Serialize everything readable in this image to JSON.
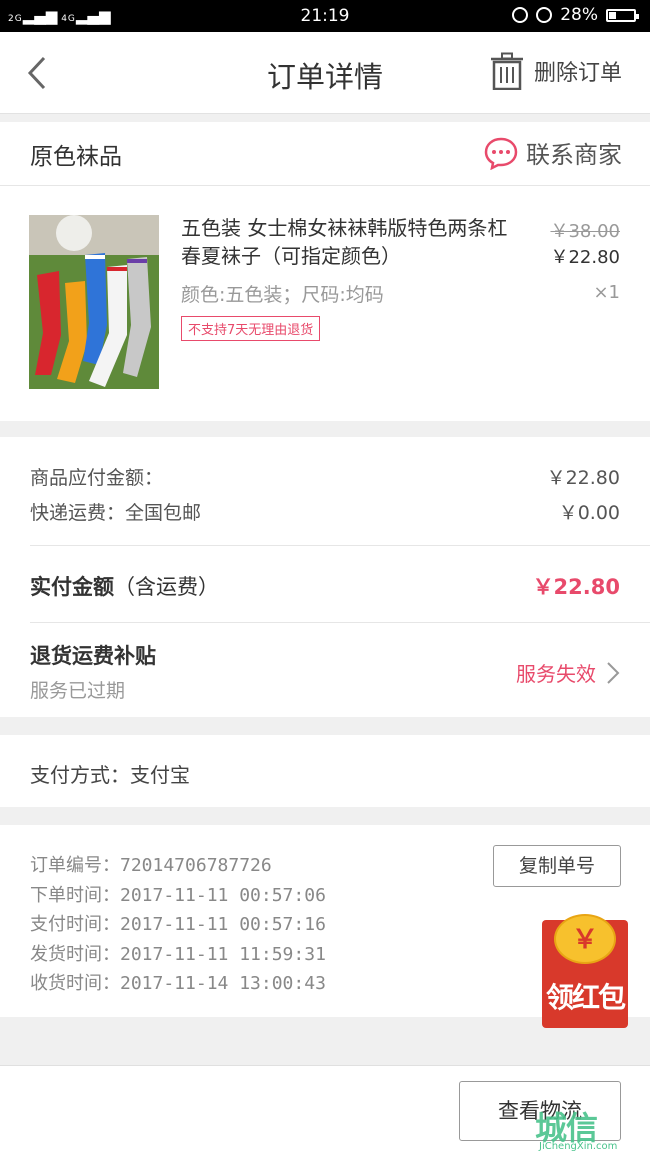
{
  "status_bar": {
    "network_left": "2G",
    "network_right": "4G",
    "time": "21:19",
    "battery": "28%",
    "battery_level": 0.28
  },
  "header": {
    "title": "订单详情",
    "delete_label": "删除订单"
  },
  "shop": {
    "name": "原色袜品",
    "contact_label": "联系商家"
  },
  "product": {
    "title": "五色装 女士棉女袜袜韩版特色两条杠春夏袜子（可指定颜色）",
    "attributes": "颜色:五色装；尺码:均码",
    "tag": "不支持7天无理由退货",
    "original_price": "￥38.00",
    "price": "￥22.80",
    "quantity": "×1"
  },
  "summary": {
    "goods_label": "商品应付金额：",
    "goods_value": "￥22.80",
    "shipping_label": "快递运费：全国包邮",
    "shipping_value": "￥0.00",
    "paid_label": "实付金额",
    "paid_label_note": "（含运费）",
    "paid_value": "￥22.80",
    "subsidy_title": "退货运费补贴",
    "subsidy_sub": "服务已过期",
    "subsidy_status": "服务失效"
  },
  "payment": {
    "text": "支付方式：支付宝"
  },
  "order_info": {
    "order_no": "订单编号：72014706787726",
    "created": "下单时间：2017-11-11  00:57:06",
    "paid": "支付时间：2017-11-11  00:57:16",
    "shipped": "发货时间：2017-11-11  11:59:31",
    "received": "收货时间：2017-11-14  13:00:43",
    "copy_button": "复制单号"
  },
  "red_packet": {
    "coin_symbol": "￥",
    "label": "领红包"
  },
  "bottom": {
    "logistics_button": "查看物流"
  },
  "watermark": {
    "text": "城信",
    "domain": "JiChengXin.com"
  },
  "colors": {
    "accent": "#e84a6b",
    "red_packet": "#d8392b",
    "coin": "#f7c12d"
  }
}
